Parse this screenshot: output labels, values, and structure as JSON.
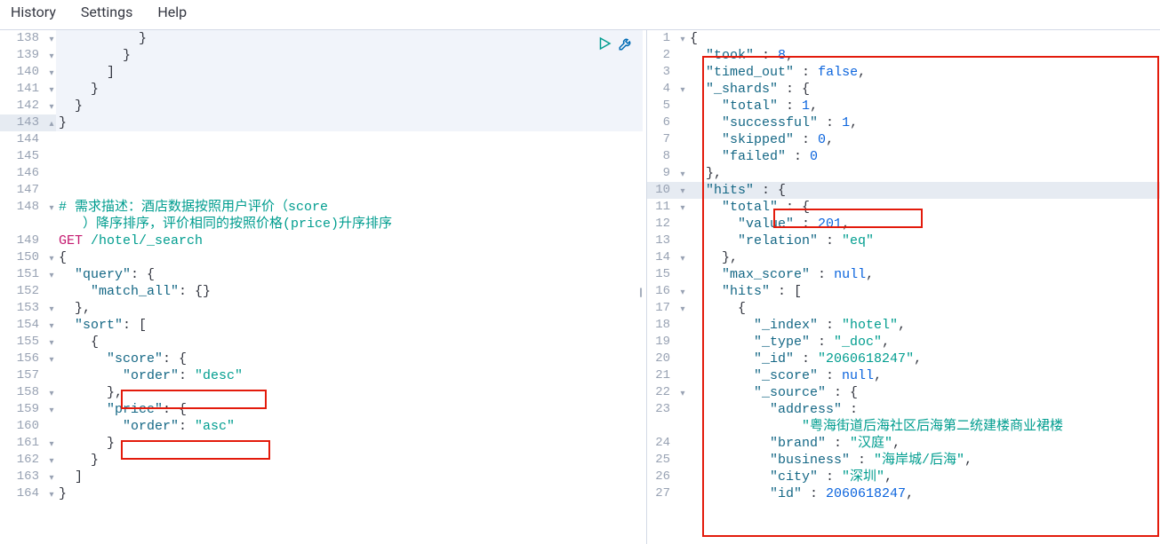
{
  "menu": {
    "history": "History",
    "settings": "Settings",
    "help": "Help"
  },
  "left": {
    "method": "GET",
    "path": "/hotel/_search",
    "comment": "# 需求描述：酒店数据按照用户评价（score",
    "comment_wrap": "）降序排序，评价相同的按照价格(price)升序排序",
    "query_key": "\"query\"",
    "match_all_key": "\"match_all\"",
    "sort_key": "\"sort\"",
    "score_key": "\"score\"",
    "price_key": "\"price\"",
    "order_key": "\"order\"",
    "desc": "\"desc\"",
    "asc": "\"asc\"",
    "lines": {
      "138": "138",
      "139": "139",
      "140": "140",
      "141": "141",
      "142": "142",
      "143": "143",
      "144": "144",
      "145": "145",
      "146": "146",
      "147": "147",
      "148": "148",
      "149": "149",
      "150": "150",
      "151": "151",
      "152": "152",
      "153": "153",
      "154": "154",
      "155": "155",
      "156": "156",
      "157": "157",
      "158": "158",
      "159": "159",
      "160": "160",
      "161": "161",
      "162": "162",
      "163": "163",
      "164": "164"
    }
  },
  "right": {
    "k_took": "\"took\"",
    "v_took": "8",
    "k_timed_out": "\"timed_out\"",
    "v_timed_out": "false",
    "k_shards": "\"_shards\"",
    "k_total": "\"total\"",
    "v_total1": "1",
    "k_successful": "\"successful\"",
    "v_successful": "1",
    "k_skipped": "\"skipped\"",
    "v_skipped": "0",
    "k_failed": "\"failed\"",
    "v_failed": "0",
    "k_hits": "\"hits\"",
    "k_value": "\"value\"",
    "v_value": "201",
    "k_relation": "\"relation\"",
    "v_relation": "\"eq\"",
    "k_max_score": "\"max_score\"",
    "v_null": "null",
    "k_index": "\"_index\"",
    "v_index": "\"hotel\"",
    "k_type": "\"_type\"",
    "v_type": "\"_doc\"",
    "k_id": "\"_id\"",
    "v_id": "\"2060618247\"",
    "k_score": "\"_score\"",
    "k_source": "\"_source\"",
    "k_address": "\"address\"",
    "v_address": "\"粤海街道后海社区后海第二统建楼商业裙楼",
    "k_brand": "\"brand\"",
    "v_brand": "\"汉庭\"",
    "k_business": "\"business\"",
    "v_business": "\"海岸城/后海\"",
    "k_city": "\"city\"",
    "v_city": "\"深圳\"",
    "k_id2": "\"id\"",
    "v_id2": "2060618247",
    "lines": {
      "1": "1",
      "2": "2",
      "3": "3",
      "4": "4",
      "5": "5",
      "6": "6",
      "7": "7",
      "8": "8",
      "9": "9",
      "10": "10",
      "11": "11",
      "12": "12",
      "13": "13",
      "14": "14",
      "15": "15",
      "16": "16",
      "17": "17",
      "18": "18",
      "19": "19",
      "20": "20",
      "21": "21",
      "22": "22",
      "23": "23",
      "24": "24",
      "25": "25",
      "26": "26",
      "27": "27"
    }
  }
}
